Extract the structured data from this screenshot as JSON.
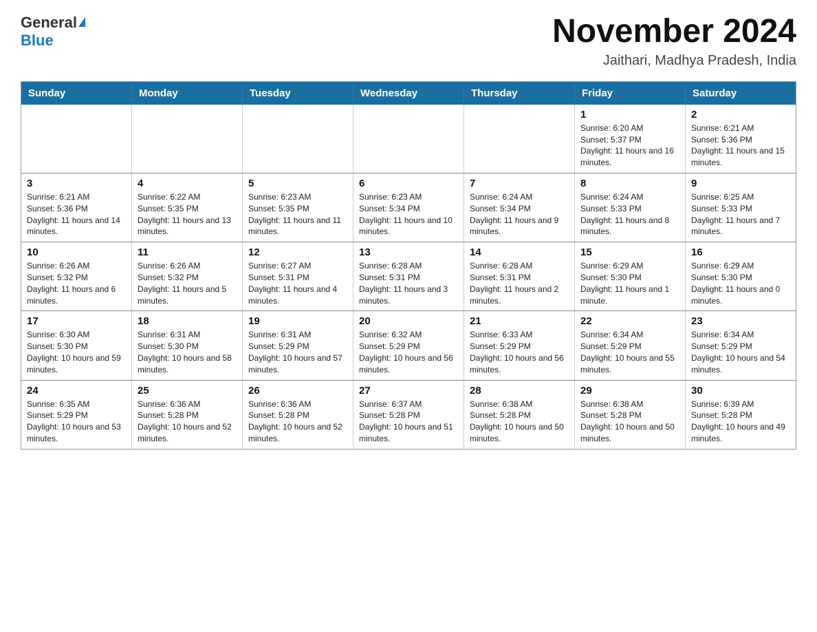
{
  "header": {
    "logo_general": "General",
    "logo_blue": "Blue",
    "title": "November 2024",
    "subtitle": "Jaithari, Madhya Pradesh, India"
  },
  "weekdays": [
    "Sunday",
    "Monday",
    "Tuesday",
    "Wednesday",
    "Thursday",
    "Friday",
    "Saturday"
  ],
  "weeks": [
    [
      {
        "day": "",
        "info": ""
      },
      {
        "day": "",
        "info": ""
      },
      {
        "day": "",
        "info": ""
      },
      {
        "day": "",
        "info": ""
      },
      {
        "day": "",
        "info": ""
      },
      {
        "day": "1",
        "info": "Sunrise: 6:20 AM\nSunset: 5:37 PM\nDaylight: 11 hours and 16 minutes."
      },
      {
        "day": "2",
        "info": "Sunrise: 6:21 AM\nSunset: 5:36 PM\nDaylight: 11 hours and 15 minutes."
      }
    ],
    [
      {
        "day": "3",
        "info": "Sunrise: 6:21 AM\nSunset: 5:36 PM\nDaylight: 11 hours and 14 minutes."
      },
      {
        "day": "4",
        "info": "Sunrise: 6:22 AM\nSunset: 5:35 PM\nDaylight: 11 hours and 13 minutes."
      },
      {
        "day": "5",
        "info": "Sunrise: 6:23 AM\nSunset: 5:35 PM\nDaylight: 11 hours and 11 minutes."
      },
      {
        "day": "6",
        "info": "Sunrise: 6:23 AM\nSunset: 5:34 PM\nDaylight: 11 hours and 10 minutes."
      },
      {
        "day": "7",
        "info": "Sunrise: 6:24 AM\nSunset: 5:34 PM\nDaylight: 11 hours and 9 minutes."
      },
      {
        "day": "8",
        "info": "Sunrise: 6:24 AM\nSunset: 5:33 PM\nDaylight: 11 hours and 8 minutes."
      },
      {
        "day": "9",
        "info": "Sunrise: 6:25 AM\nSunset: 5:33 PM\nDaylight: 11 hours and 7 minutes."
      }
    ],
    [
      {
        "day": "10",
        "info": "Sunrise: 6:26 AM\nSunset: 5:32 PM\nDaylight: 11 hours and 6 minutes."
      },
      {
        "day": "11",
        "info": "Sunrise: 6:26 AM\nSunset: 5:32 PM\nDaylight: 11 hours and 5 minutes."
      },
      {
        "day": "12",
        "info": "Sunrise: 6:27 AM\nSunset: 5:31 PM\nDaylight: 11 hours and 4 minutes."
      },
      {
        "day": "13",
        "info": "Sunrise: 6:28 AM\nSunset: 5:31 PM\nDaylight: 11 hours and 3 minutes."
      },
      {
        "day": "14",
        "info": "Sunrise: 6:28 AM\nSunset: 5:31 PM\nDaylight: 11 hours and 2 minutes."
      },
      {
        "day": "15",
        "info": "Sunrise: 6:29 AM\nSunset: 5:30 PM\nDaylight: 11 hours and 1 minute."
      },
      {
        "day": "16",
        "info": "Sunrise: 6:29 AM\nSunset: 5:30 PM\nDaylight: 11 hours and 0 minutes."
      }
    ],
    [
      {
        "day": "17",
        "info": "Sunrise: 6:30 AM\nSunset: 5:30 PM\nDaylight: 10 hours and 59 minutes."
      },
      {
        "day": "18",
        "info": "Sunrise: 6:31 AM\nSunset: 5:30 PM\nDaylight: 10 hours and 58 minutes."
      },
      {
        "day": "19",
        "info": "Sunrise: 6:31 AM\nSunset: 5:29 PM\nDaylight: 10 hours and 57 minutes."
      },
      {
        "day": "20",
        "info": "Sunrise: 6:32 AM\nSunset: 5:29 PM\nDaylight: 10 hours and 56 minutes."
      },
      {
        "day": "21",
        "info": "Sunrise: 6:33 AM\nSunset: 5:29 PM\nDaylight: 10 hours and 56 minutes."
      },
      {
        "day": "22",
        "info": "Sunrise: 6:34 AM\nSunset: 5:29 PM\nDaylight: 10 hours and 55 minutes."
      },
      {
        "day": "23",
        "info": "Sunrise: 6:34 AM\nSunset: 5:29 PM\nDaylight: 10 hours and 54 minutes."
      }
    ],
    [
      {
        "day": "24",
        "info": "Sunrise: 6:35 AM\nSunset: 5:29 PM\nDaylight: 10 hours and 53 minutes."
      },
      {
        "day": "25",
        "info": "Sunrise: 6:36 AM\nSunset: 5:28 PM\nDaylight: 10 hours and 52 minutes."
      },
      {
        "day": "26",
        "info": "Sunrise: 6:36 AM\nSunset: 5:28 PM\nDaylight: 10 hours and 52 minutes."
      },
      {
        "day": "27",
        "info": "Sunrise: 6:37 AM\nSunset: 5:28 PM\nDaylight: 10 hours and 51 minutes."
      },
      {
        "day": "28",
        "info": "Sunrise: 6:38 AM\nSunset: 5:28 PM\nDaylight: 10 hours and 50 minutes."
      },
      {
        "day": "29",
        "info": "Sunrise: 6:38 AM\nSunset: 5:28 PM\nDaylight: 10 hours and 50 minutes."
      },
      {
        "day": "30",
        "info": "Sunrise: 6:39 AM\nSunset: 5:28 PM\nDaylight: 10 hours and 49 minutes."
      }
    ]
  ]
}
